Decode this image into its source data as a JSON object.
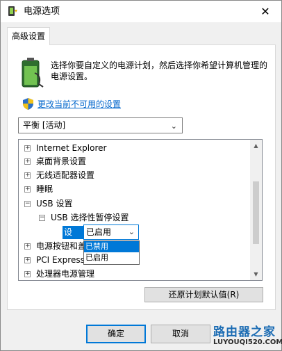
{
  "window": {
    "title": "电源选项",
    "close_glyph": "✕"
  },
  "tab": {
    "label": "高级设置"
  },
  "intro_text": "选择你要自定义的电源计划，然后选择你希望计算机管理的电源设置。",
  "change_link": "更改当前不可用的设置",
  "plan_select": {
    "value": "平衡 [活动]"
  },
  "tree": {
    "items": [
      {
        "label": "Internet Explorer",
        "expander": "+"
      },
      {
        "label": "桌面背景设置",
        "expander": "+"
      },
      {
        "label": "无线适配器设置",
        "expander": "+"
      },
      {
        "label": "睡眠",
        "expander": "+"
      },
      {
        "label": "USB 设置",
        "expander": "−"
      },
      {
        "label": "USB 选择性暂停设置",
        "expander": "−"
      },
      {
        "label": "电源按钮和盖",
        "expander": "+"
      },
      {
        "label": "PCI Express",
        "expander": "+"
      },
      {
        "label": "处理器电源管理",
        "expander": "+"
      }
    ],
    "setting_label": "设置:",
    "setting_value": "已启用",
    "dropdown_options": [
      "已禁用",
      "已启用"
    ],
    "dropdown_selected": "已禁用"
  },
  "buttons": {
    "restore": "还原计划默认值(R)",
    "ok": "确定",
    "cancel": "取消"
  },
  "watermark": {
    "line1": "路由器之家",
    "line2": "LUYOUQI520.COM"
  },
  "colors": {
    "accent": "#0078d7",
    "link": "#0066cc"
  }
}
